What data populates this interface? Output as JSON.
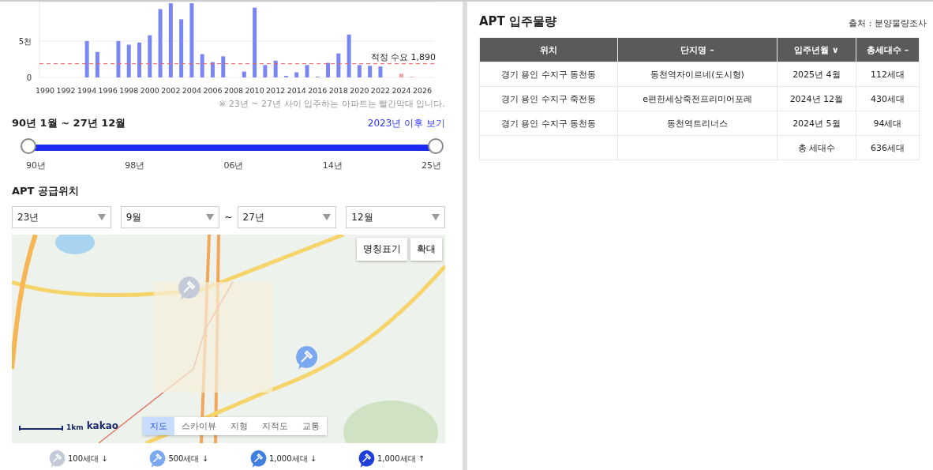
{
  "chart": {
    "chart_data": {
      "type": "bar",
      "categories": [
        "1990",
        null,
        "1992",
        null,
        "1994",
        null,
        "1996",
        null,
        "1998",
        null,
        "2000",
        null,
        "2002",
        null,
        "2004",
        null,
        "2006",
        null,
        "2008",
        null,
        "2010",
        null,
        "2012",
        null,
        "2014",
        null,
        "2016",
        null,
        "2018",
        null,
        "2020",
        null,
        "2022",
        null,
        "2024",
        null,
        "2026"
      ],
      "series": [
        {
          "color": "#7b86f5",
          "values": [
            null,
            null,
            null,
            null,
            5.0,
            3.5,
            null,
            5.0,
            4.5,
            4.8,
            5.8,
            9.4,
            10.2,
            8.0,
            10.2,
            3.2,
            2.1,
            2.9,
            null,
            0.8,
            9.6,
            1.7,
            2.3,
            0.2,
            0.7,
            1.7,
            0.1,
            2.0,
            3.3,
            5.9,
            1.7,
            1.6,
            1.5,
            null,
            null,
            null,
            null
          ]
        },
        {
          "color": "#f4a3a3",
          "values": [
            null,
            null,
            null,
            null,
            null,
            null,
            null,
            null,
            null,
            null,
            null,
            null,
            null,
            null,
            null,
            null,
            null,
            null,
            null,
            null,
            null,
            null,
            null,
            null,
            null,
            null,
            null,
            null,
            null,
            null,
            null,
            null,
            null,
            null,
            0.5,
            0.1,
            null
          ]
        }
      ],
      "stacked": true,
      "ylim": [
        0,
        10.4
      ],
      "yticks": [
        0,
        {
          "value": 5,
          "label": "5천"
        }
      ],
      "ref_lines": [
        {
          "axis": "y",
          "value": 1.89,
          "label": "적정 수요 1,890"
        }
      ]
    },
    "note": "※ 23년 ~ 27년 사이 입주하는 아파트는 빨간막대 입니다."
  },
  "period": {
    "label": "90년 1월 ~ 27년 12월",
    "link": "2023년 이후 보기",
    "slider": {
      "start": {
        "level": 0
      },
      "end": {
        "level": 1
      }
    },
    "ticks": [
      "90년",
      "98년",
      "06년",
      "14년",
      "25년"
    ]
  },
  "location": {
    "title": "APT 공급위치",
    "selects": [
      {
        "value": "23년"
      },
      {
        "value": "9월"
      },
      {
        "value": "27년"
      },
      {
        "value": "12월"
      }
    ],
    "separator": "~"
  },
  "map": {
    "buttons": [
      "명칭표기",
      "확대"
    ],
    "scale": "1km",
    "logo": "kakao",
    "map_types": [
      {
        "label": "지도",
        "selected": true
      },
      {
        "label": "스카이뷰",
        "selected": false
      },
      {
        "label": "지형",
        "selected": false
      },
      {
        "label": "지적도",
        "selected": false
      },
      {
        "label": "교통",
        "selected": false
      }
    ],
    "markers": [
      {
        "color": "#c5cad8"
      },
      {
        "color": "#7aa9f0"
      }
    ]
  },
  "legend": [
    {
      "label": "100세대 ↓",
      "color": "#c5cad8"
    },
    {
      "label": "500세대 ↓",
      "color": "#7aa9f0"
    },
    {
      "label": "1,000세대 ↓",
      "color": "#3f7fe0"
    },
    {
      "label": "1,000세대 ↑",
      "color": "#1f3fd8"
    }
  ],
  "supply": {
    "title": "APT 입주물량",
    "source": "출처 : 분양물량조사",
    "columns": [
      "위치",
      "단지명 –",
      "입주년월 ∨",
      "총세대수 –"
    ],
    "rows": [
      [
        "경기 용인 수지구 동천동",
        "동천역자이르네(도시형)",
        "2025년 4월",
        "112세대"
      ],
      [
        "경기 용인 수지구 죽전동",
        "e편한세상죽전프리미어포레",
        "2024년 12월",
        "430세대"
      ],
      [
        "경기 용인 수지구 동천동",
        "동천역트리너스",
        "2024년 5월",
        "94세대"
      ]
    ],
    "total": {
      "label": "총 세대수",
      "value": "636세대"
    }
  }
}
